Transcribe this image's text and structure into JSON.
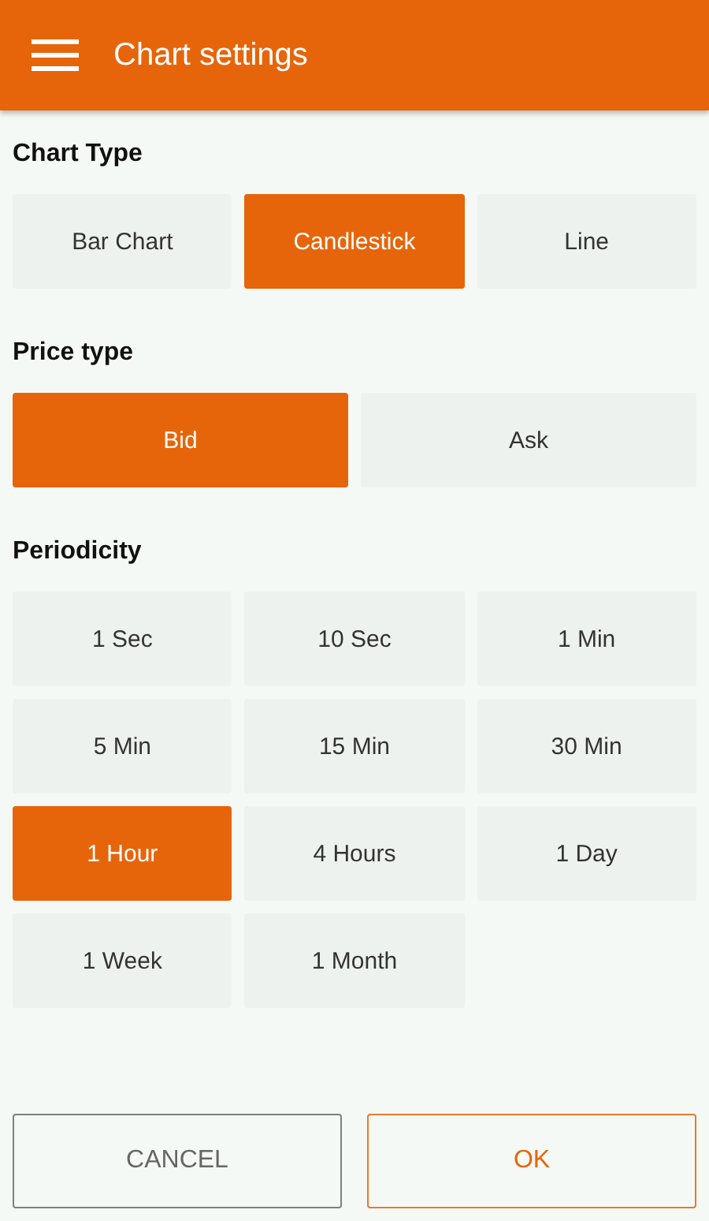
{
  "app_bar": {
    "title": "Chart settings"
  },
  "sections": [
    {
      "label": "Chart Type",
      "options": [
        {
          "label": "Bar Chart",
          "selected": false
        },
        {
          "label": "Candlestick",
          "selected": true
        },
        {
          "label": "Line",
          "selected": false
        }
      ]
    },
    {
      "label": "Price type",
      "options": [
        {
          "label": "Bid",
          "selected": true
        },
        {
          "label": "Ask",
          "selected": false
        }
      ]
    },
    {
      "label": "Periodicity",
      "options": [
        {
          "label": "1 Sec",
          "selected": false
        },
        {
          "label": "10 Sec",
          "selected": false
        },
        {
          "label": "1 Min",
          "selected": false
        },
        {
          "label": "5 Min",
          "selected": false
        },
        {
          "label": "15 Min",
          "selected": false
        },
        {
          "label": "30 Min",
          "selected": false
        },
        {
          "label": "1 Hour",
          "selected": true
        },
        {
          "label": "4 Hours",
          "selected": false
        },
        {
          "label": "1 Day",
          "selected": false
        },
        {
          "label": "1 Week",
          "selected": false
        },
        {
          "label": "1 Month",
          "selected": false
        }
      ]
    }
  ],
  "buttons": [
    {
      "label": "CANCEL",
      "kind": "cancel"
    },
    {
      "label": "OK",
      "kind": "ok"
    }
  ]
}
